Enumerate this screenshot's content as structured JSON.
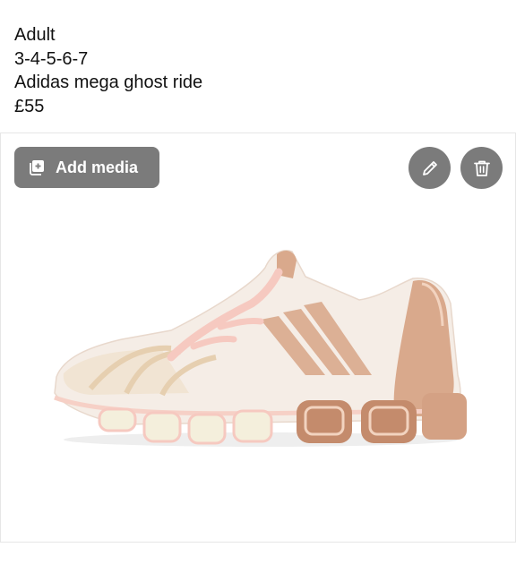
{
  "post": {
    "line1": "Adult",
    "line2": "3-4-5-6-7",
    "line3": "Adidas mega ghost ride",
    "line4": "£55"
  },
  "media": {
    "add_label": "Add media",
    "add_icon": "add-photo-icon",
    "edit_icon": "pencil-icon",
    "delete_icon": "trash-icon",
    "button_color": "#7b7b7b",
    "image": "white and rose-gold sneaker"
  }
}
